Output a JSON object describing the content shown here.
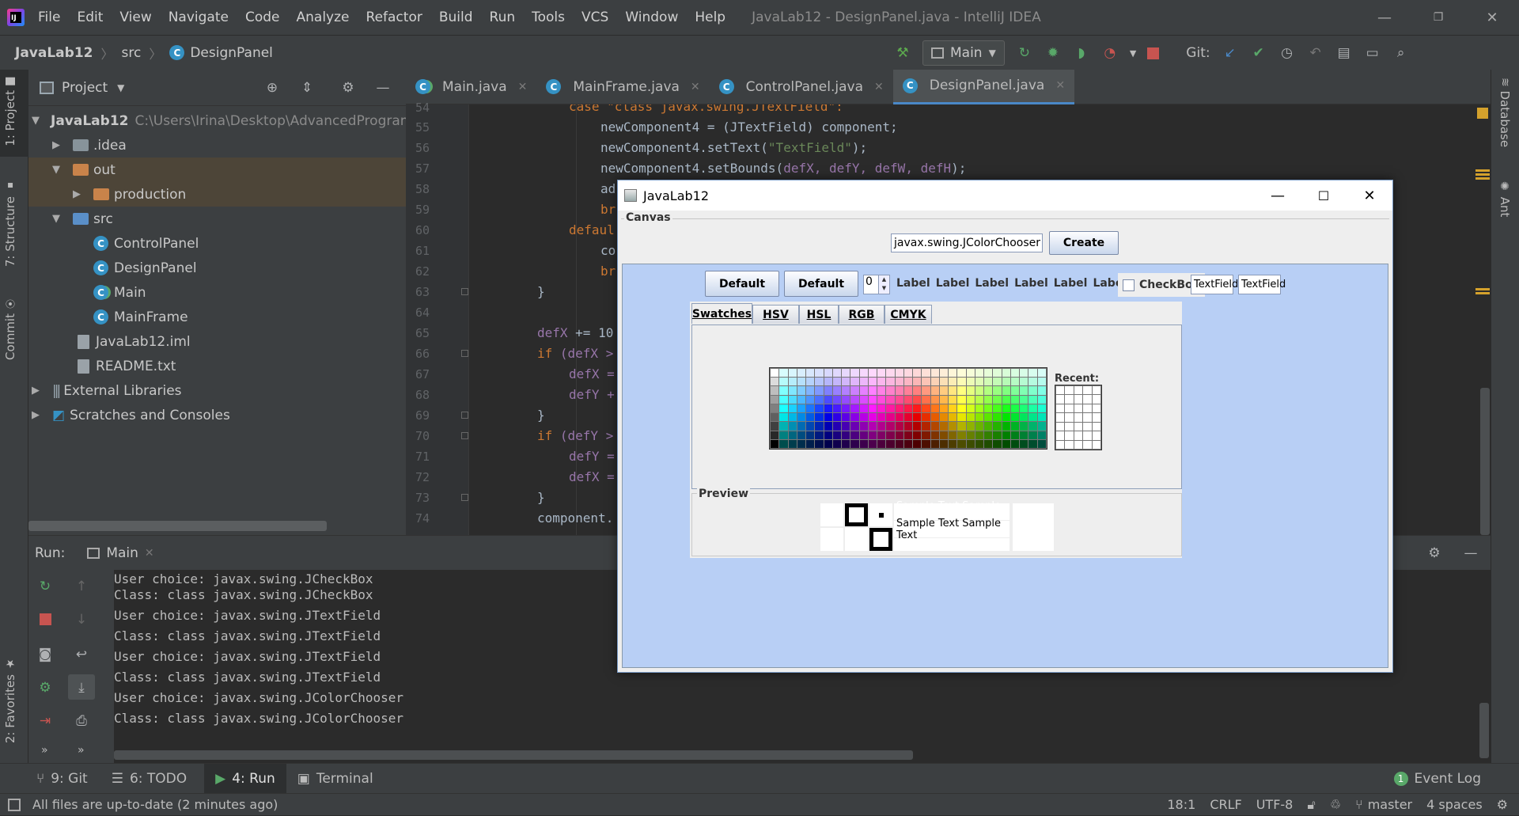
{
  "titlebar": {
    "menus": [
      "File",
      "Edit",
      "View",
      "Navigate",
      "Code",
      "Analyze",
      "Refactor",
      "Build",
      "Run",
      "Tools",
      "VCS",
      "Window",
      "Help"
    ],
    "title": "JavaLab12 - DesignPanel.java - IntelliJ IDEA"
  },
  "navbar": {
    "crumbs": [
      "JavaLab12",
      "src",
      "DesignPanel"
    ],
    "run_config": "Main",
    "git_label": "Git:"
  },
  "stripe": {
    "project": "1: Project",
    "structure": "7: Structure",
    "commit": "Commit",
    "favorites": "2: Favorites",
    "database": "Database",
    "ant": "Ant"
  },
  "project": {
    "header": "Project",
    "root": "JavaLab12",
    "root_path": "C:\\Users\\Irina\\Desktop\\AdvancedProgramm",
    "items": {
      "idea": ".idea",
      "out": "out",
      "production": "production",
      "src": "src",
      "c1": "ControlPanel",
      "c2": "DesignPanel",
      "c3": "Main",
      "c4": "MainFrame",
      "iml": "JavaLab12.iml",
      "readme": "README.txt",
      "extlib": "External Libraries",
      "scratch": "Scratches and Consoles"
    }
  },
  "editor": {
    "tabs": [
      "Main.java",
      "MainFrame.java",
      "ControlPanel.java",
      "DesignPanel.java"
    ],
    "line_numbers": [
      "54",
      "55",
      "56",
      "57",
      "58",
      "59",
      "60",
      "61",
      "62",
      "63",
      "64",
      "65",
      "66",
      "67",
      "68",
      "69",
      "70",
      "71",
      "72",
      "73",
      "74"
    ],
    "lines": {
      "l54": "case \"class javax.swing.JTextField\":",
      "l55": "newComponent4 = (JTextField) component;",
      "l56a": "newComponent4.setText(",
      "l56b": "\"TextField\"",
      "l56c": ");",
      "l57a": "newComponent4.setBounds(",
      "l57b": "defX, defY, defW, defH",
      "l57c": ");",
      "l58": "ad",
      "l59": "br",
      "l60": "defaul",
      "l61": "co",
      "l62": "br",
      "l63": "}",
      "l65a": "defX",
      "l65b": " += 10",
      "l66a": "if",
      "l66b": " (defX >",
      "l67": "defX =",
      "l68": "defY +",
      "l69": "}",
      "l70a": "if",
      "l70b": " (defY >",
      "l71": "defY =",
      "l72": "defX =",
      "l73": "}",
      "l74": "component."
    }
  },
  "run": {
    "label": "Run:",
    "tab": "Main",
    "console": [
      "User choice: javax.swing.JCheckBox",
      "Class: class javax.swing.JCheckBox",
      "User choice: javax.swing.JTextField",
      "Class: class javax.swing.JTextField",
      "User choice: javax.swing.JTextField",
      "Class: class javax.swing.JTextField",
      "User choice: javax.swing.JColorChooser",
      "Class: class javax.swing.JColorChooser"
    ]
  },
  "bottomtabs": {
    "git": "9: Git",
    "todo": "6: TODO",
    "run": "4: Run",
    "terminal": "Terminal",
    "eventlog": "Event Log",
    "eventcount": "1"
  },
  "status": {
    "message": "All files are up-to-date (2 minutes ago)",
    "pos": "18:1",
    "lf": "CRLF",
    "enc": "UTF-8",
    "branch": "master",
    "indent": "4 spaces"
  },
  "swing": {
    "title": "JavaLab12",
    "canvas_label": "Canvas",
    "class_input": "javax.swing.JColorChooser",
    "create_button": "Create",
    "default1": "Default",
    "default2": "Default",
    "spinner_value": "0",
    "labels": [
      "Label",
      "Label",
      "Label",
      "Label",
      "Label",
      "Label"
    ],
    "checkbox": "CheckBox",
    "textfield1": "TextField",
    "textfield2": "TextField",
    "cc_tabs": [
      "Swatches",
      "HSV",
      "HSL",
      "RGB",
      "CMYK"
    ],
    "recent_label": "Recent:",
    "preview_label": "Preview",
    "sample": "Sample Text  Sample Text",
    "colors": {
      "canvas_bg": "#b8cff5",
      "accent": "#4a88c7"
    }
  }
}
